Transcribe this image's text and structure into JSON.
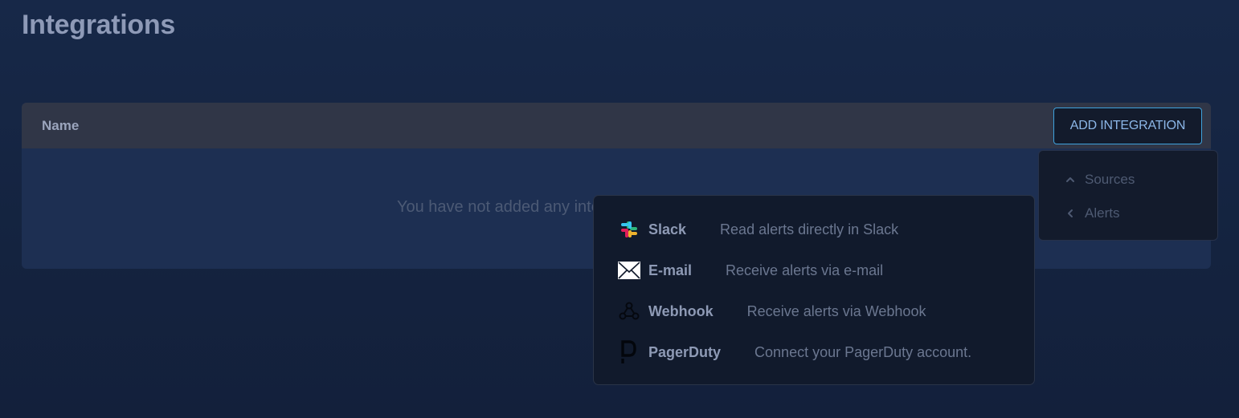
{
  "page": {
    "title": "Integrations"
  },
  "table": {
    "columns": [
      "Name"
    ],
    "empty_message": "You have not added any integrations yet."
  },
  "toolbar": {
    "add_integration_label": "ADD INTEGRATION"
  },
  "side_menu": {
    "items": [
      {
        "label": "Sources",
        "icon": "chevron-up-icon"
      },
      {
        "label": "Alerts",
        "icon": "chevron-left-icon"
      }
    ]
  },
  "dropdown": {
    "items": [
      {
        "name": "Slack",
        "description": "Read alerts directly in Slack",
        "icon": "slack-icon"
      },
      {
        "name": "E-mail",
        "description": "Receive alerts via e-mail",
        "icon": "envelope-icon"
      },
      {
        "name": "Webhook",
        "description": "Receive alerts via Webhook",
        "icon": "webhook-icon"
      },
      {
        "name": "PagerDuty",
        "description": "Connect your PagerDuty account.",
        "icon": "pagerduty-icon"
      }
    ]
  },
  "colors": {
    "accent": "#3ea2dd",
    "slack_blue": "#36c5f0",
    "slack_green": "#2eb67d",
    "slack_red": "#e01e5a",
    "slack_yellow": "#ecb22e"
  }
}
